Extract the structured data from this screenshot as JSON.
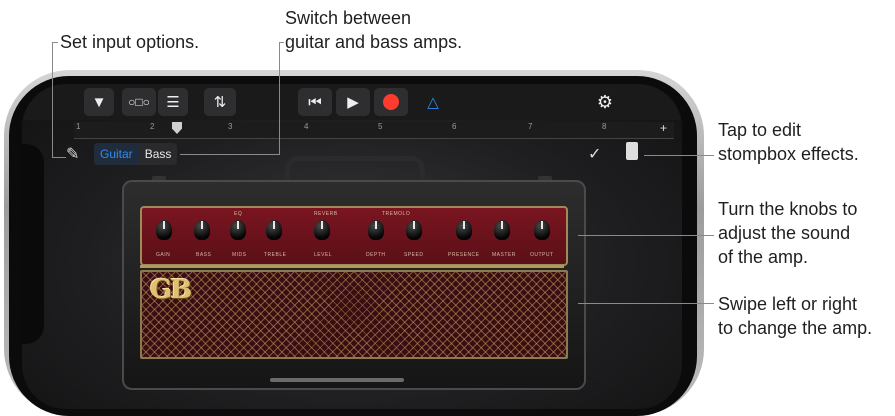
{
  "callouts": {
    "input_options": "Set input options.",
    "switch_amps": "Switch between\nguitar and bass amps.",
    "stompbox": "Tap to edit\nstompbox effects.",
    "knobs": "Turn the knobs to\nadjust the sound\nof the amp.",
    "swipe": "Swipe left or right\nto change the amp."
  },
  "toolbar": {
    "icons": [
      "dropdown-icon",
      "tracks-view-icon",
      "mixer-list-icon",
      "eq-sliders-icon",
      "rewind-icon",
      "play-icon",
      "record-icon",
      "metronome-icon",
      "settings-icon"
    ],
    "record_color": "#ff3b30",
    "metronome_color": "#2e8cf0"
  },
  "ruler": {
    "marks": [
      "1",
      "2",
      "3",
      "4",
      "5",
      "6",
      "7",
      "8"
    ],
    "add_label": "+"
  },
  "amp_selector": {
    "selected": "Guitar",
    "other": "Bass"
  },
  "amp": {
    "logo": "GB",
    "groups": [
      "EQ",
      "REVERB",
      "TREMOLO"
    ],
    "knobs": [
      "GAIN",
      "BASS",
      "MIDS",
      "TREBLE",
      "LEVEL",
      "DEPTH",
      "SPEED",
      "PRESENCE",
      "MASTER",
      "OUTPUT"
    ]
  }
}
